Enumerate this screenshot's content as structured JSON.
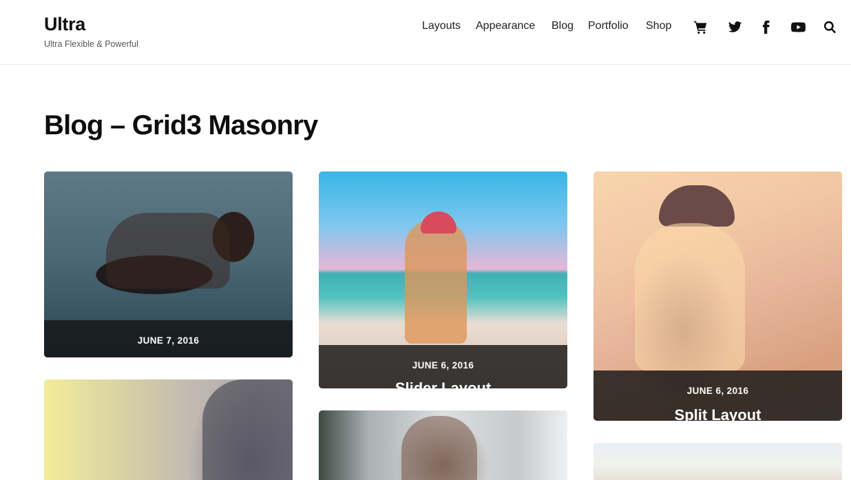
{
  "site": {
    "title": "Ultra",
    "tagline": "Ultra Flexible & Powerful"
  },
  "nav": {
    "links": [
      "Layouts",
      "Appearance",
      "Blog",
      "Portfolio",
      "Shop"
    ],
    "icons": [
      "cart-icon",
      "twitter-icon",
      "facebook-icon",
      "youtube-icon",
      "search-icon"
    ]
  },
  "page": {
    "title": "Blog – Grid3 Masonry"
  },
  "posts": [
    {
      "date": "JUNE 7, 2016",
      "title": ""
    },
    {
      "date": "JUNE 6, 2016",
      "title": "Slider Layout"
    },
    {
      "date": "JUNE 6, 2016",
      "title": "Split Layout"
    },
    {
      "date": "",
      "title": ""
    },
    {
      "date": "",
      "title": ""
    },
    {
      "date": "",
      "title": ""
    }
  ],
  "colors": {
    "overlay": "#161616",
    "text": "#111111",
    "header_border": "#ececec"
  }
}
